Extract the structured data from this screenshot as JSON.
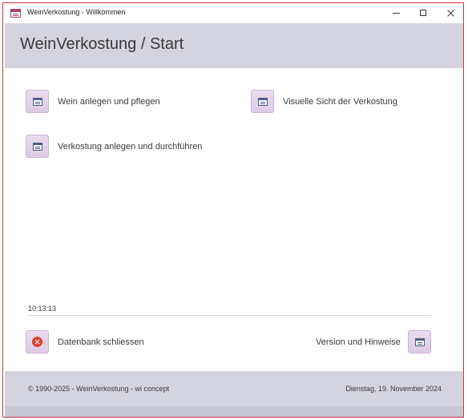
{
  "window": {
    "title": "WeinVerkostung - Willkommen"
  },
  "header": {
    "title": "WeinVerkostung / Start"
  },
  "menu": {
    "wein_anlegen": "Wein anlegen und pflegen",
    "visuelle_sicht": "Visuelle Sicht der Verkostung",
    "verkostung_anlegen": "Verkostung anlegen und durchführen"
  },
  "status": {
    "time": "10:13:13"
  },
  "actions": {
    "close_db": "Datenbank schliessen",
    "version": "Version und Hinweise"
  },
  "footer": {
    "copyright": "© 1990-2025 - WeinVerkostung - wi concept",
    "date": "Dienstag, 19. November 2024"
  },
  "colors": {
    "window_border": "#c9343f",
    "header_bg": "#d4d4de",
    "tile_bg": "#e9dcef",
    "close_icon": "#d9432f"
  }
}
